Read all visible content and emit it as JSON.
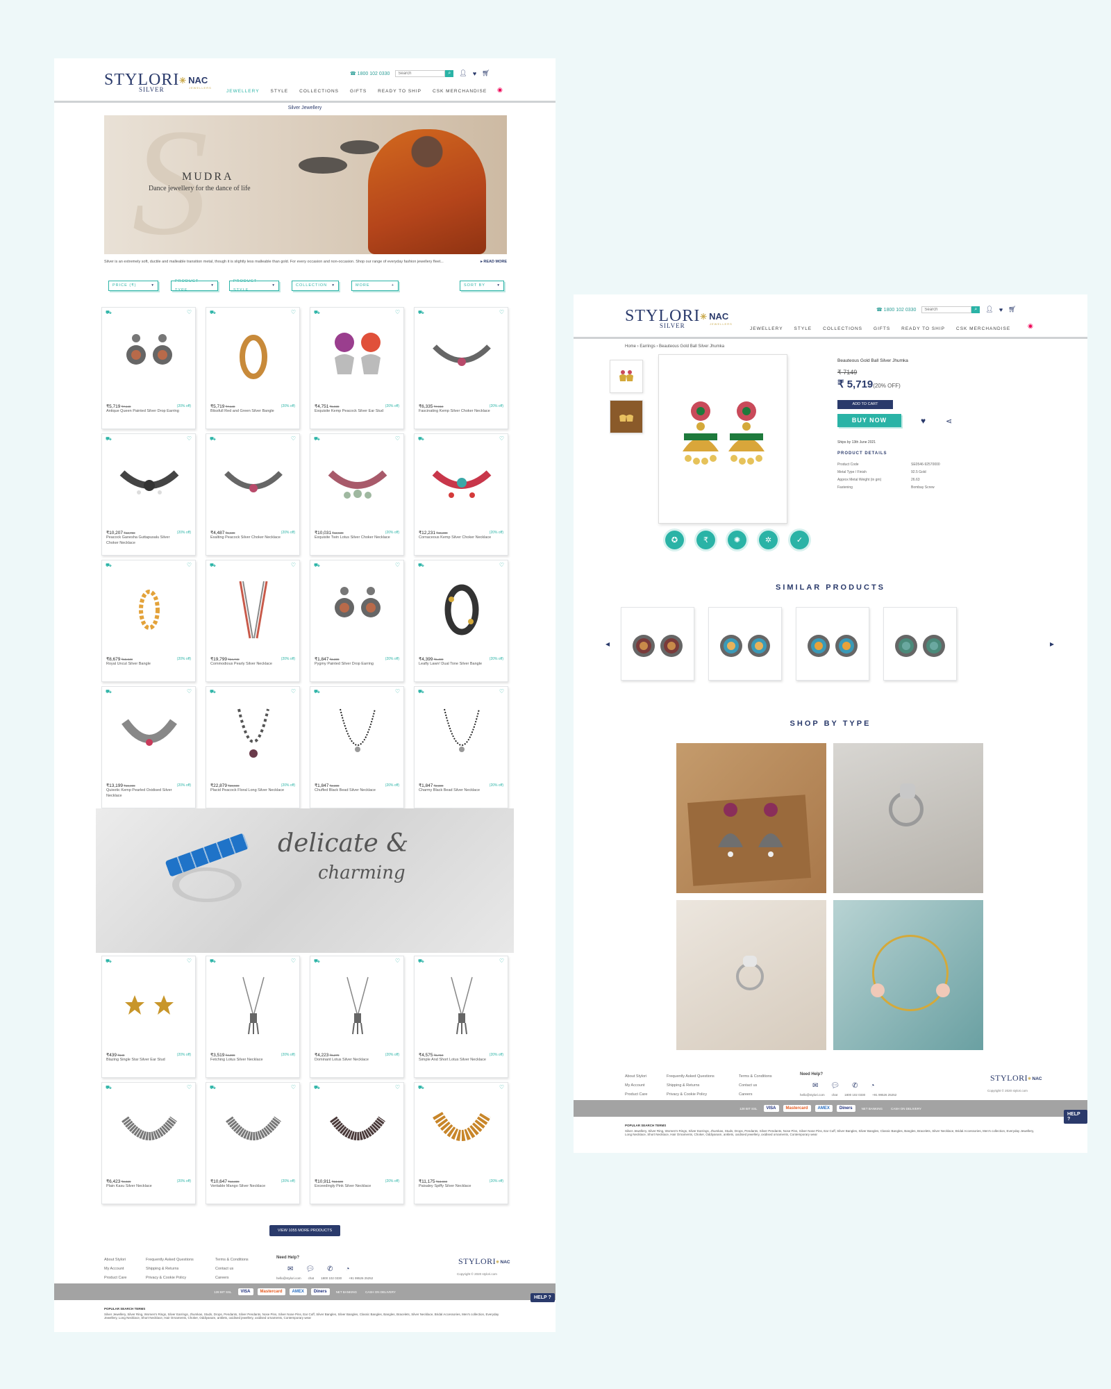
{
  "header": {
    "logo_main": "STYLORI",
    "logo_sub": "SILVER",
    "logo_partner": "NAC",
    "logo_partner_sub": "JEWELLERS",
    "phone": "1800 102 0330",
    "search_placeholder": "Search",
    "nav": [
      "JEWELLERY",
      "STYLE",
      "COLLECTIONS",
      "GIFTS",
      "READY TO SHIP",
      "CSK MERCHANDISE"
    ]
  },
  "listing": {
    "category_title": "Silver Jewellery",
    "banner_title": "MUDRA",
    "banner_subtitle": "Dance jewellery for the dance of life",
    "intro_text": "Silver is an extremely soft, ductile and malleable transition metal, though it is slightly less malleable than gold. For every occasion and non-occasion. Shop our range of everyday fashion jewellery fleet...",
    "read_more": "▸ READ MORE",
    "filters": [
      {
        "label": "PRICE (₹)",
        "caret": "▾"
      },
      {
        "label": "PRODUCT TYPE",
        "caret": "▾"
      },
      {
        "label": "PRODUCT STYLE",
        "caret": "▾"
      },
      {
        "label": "COLLECTION",
        "caret": "▾"
      },
      {
        "label": "MORE",
        "caret": "+"
      },
      {
        "label": "SORT BY",
        "caret": "▾"
      }
    ],
    "products_top": [
      {
        "price": "₹5,719",
        "mrp": "₹7,149",
        "off": "(20% off)",
        "name": "Antique Queen Painted Silver Drop Earring",
        "img": "drop-earrings"
      },
      {
        "price": "₹5,719",
        "mrp": "₹7,149",
        "off": "(20% off)",
        "name": "Blissfull Red and Green Silver Bangle",
        "img": "bangle-gold"
      },
      {
        "price": "₹4,751",
        "mrp": "₹5,939",
        "off": "(20% off)",
        "name": "Exquisite Kemp Peacock Silver Ear Stud",
        "img": "kemp-earrings"
      },
      {
        "price": "₹6,335",
        "mrp": "₹7,919",
        "off": "(20% off)",
        "name": "Fascinating Kemp Silver Choker Necklace",
        "img": "choker"
      },
      {
        "price": "₹10,207",
        "mrp": "₹12,759",
        "off": "(20% off)",
        "name": "Peacock Ganesha Guttapusalu Silver Choker Necklace",
        "img": "choker-dark"
      },
      {
        "price": "₹4,487",
        "mrp": "₹5,609",
        "off": "(20% off)",
        "name": "Exalting Peacock Silver Choker Necklace",
        "img": "choker"
      },
      {
        "price": "₹10,031",
        "mrp": "₹12,539",
        "off": "(20% off)",
        "name": "Exquisite Twin Lotus Silver Choker Necklace",
        "img": "choker-pink"
      },
      {
        "price": "₹12,231",
        "mrp": "₹15,289",
        "off": "(20% off)",
        "name": "Cornaceous Kemp Silver Choker Necklace",
        "img": "choker-red"
      },
      {
        "price": "₹8,679",
        "mrp": "₹10,849",
        "off": "(20% off)",
        "name": "Royal Uncut Silver Bangle",
        "img": "bangle-stones"
      },
      {
        "price": "₹19,799",
        "mrp": "₹24,749",
        "off": "(20% off)",
        "name": "Commodious Pearly Silver Necklace",
        "img": "long-necklace"
      },
      {
        "price": "₹1,847",
        "mrp": "₹2,309",
        "off": "(20% off)",
        "name": "Pygmy Painted Silver Drop Earring",
        "img": "drop-earrings"
      },
      {
        "price": "₹4,399",
        "mrp": "₹5,499",
        "off": "(20% off)",
        "name": "Leafly Lawn! Dual Tone Silver Bangle",
        "img": "bangle-dark"
      },
      {
        "price": "₹13,199",
        "mrp": "₹16,499",
        "off": "(20% off)",
        "name": "Quixotic Kemp Pearled Oxidised Silver Necklace",
        "img": "collar"
      },
      {
        "price": "₹22,879",
        "mrp": "₹28,599",
        "off": "(20% off)",
        "name": "Placid Peacock Floral Long Silver Necklace",
        "img": "long-floral"
      },
      {
        "price": "₹1,847",
        "mrp": "₹2,309",
        "off": "(20% off)",
        "name": "Chuffed Black Bead Silver Necklace",
        "img": "black-bead"
      },
      {
        "price": "₹1,847",
        "mrp": "₹2,309",
        "off": "(20% off)",
        "name": "Charmy Black Bead Silver Necklace",
        "img": "black-bead"
      }
    ],
    "banner2_line1": "delicate &",
    "banner2_line2": "charming",
    "products_bottom": [
      {
        "price": "₹439",
        "mrp": "₹549",
        "off": "(20% off)",
        "name": "Blazing Single Star Silver Ear Stud",
        "img": "star-studs"
      },
      {
        "price": "₹3,519",
        "mrp": "₹4,399",
        "off": "(20% off)",
        "name": "Fetching Lotus Silver Necklace",
        "img": "pendant"
      },
      {
        "price": "₹4,223",
        "mrp": "₹5,279",
        "off": "(20% off)",
        "name": "Dominant Lotus Silver Necklace",
        "img": "pendant"
      },
      {
        "price": "₹4,575",
        "mrp": "₹5,719",
        "off": "(20% off)",
        "name": "Simple And Short Lotus Silver Necklace",
        "img": "pendant"
      },
      {
        "price": "₹6,423",
        "mrp": "₹8,029",
        "off": "(20% off)",
        "name": "Plain Kasu Silver Necklace",
        "img": "collar-silver"
      },
      {
        "price": "₹10,647",
        "mrp": "₹13,309",
        "off": "(20% off)",
        "name": "Veritable Mango Silver Necklace",
        "img": "collar-silver"
      },
      {
        "price": "₹10,911",
        "mrp": "₹13,639",
        "off": "(20% off)",
        "name": "Exceedingly Pink Silver Necklace",
        "img": "collar-dark"
      },
      {
        "price": "₹11,175",
        "mrp": "₹13,969",
        "off": "(20% off)",
        "name": "Paisaley Spiffy Silver Necklace",
        "img": "collar-gold"
      }
    ],
    "view_more": "VIEW 1055 MORE PRODUCTS"
  },
  "footer": {
    "col1": [
      "About Stylori",
      "My Account",
      "Product Care"
    ],
    "col2": [
      "Frequently Asked Questions",
      "Shipping & Returns",
      "Privacy & Cookie Policy"
    ],
    "col3": [
      "Terms & Conditions",
      "Contact us",
      "Careers"
    ],
    "need_help": "Need Help?",
    "contacts": [
      "hello@stylori.com",
      "chat",
      "1800 102 0330",
      "+91 99526 25252"
    ],
    "copyright": "Copyright © 2020 stylori.com",
    "payments": [
      "128 BIT SSL",
      "VISA",
      "Mastercard",
      "AMEX",
      "Diners",
      "NET BANKING",
      "CASH ON DELIVERY"
    ],
    "popular_title": "POPULAR SEARCH TERMS",
    "popular_text": "Silver Jewellery, Silver Ring, Women's Rings, Silver Earrings, Jhumkas, Studs, Drops, Pendants, Silver Pendants, Nose Pins, Silver Nose Pins, Ear Cuff, Silver Bangles, Silver Bangles, Classic Bangles, Bangles, Bracelets, Silver Necklace, Bridal Accessories, Men's collection, Everyday Jewellery, Long Necklace, Short Necklace, Hair Ornaments, Choker, Oddiyanam, anklets, oxidised jewellery, oxidised ornaments, Contemporary wear",
    "help": "HELP ?"
  },
  "product": {
    "breadcrumb": [
      "Home",
      "Earrings",
      "Beauteous Gold Ball Silver Jhumka"
    ],
    "title": "Beauteous Gold Ball Silver Jhumka",
    "mrp": "₹ 7149",
    "price": "₹ 5,719",
    "discount": "(20% OFF)",
    "add_to_cart": "ADD TO CART",
    "buy_now": "BUY NOW",
    "ships_by": "Ships by 13th June 2021",
    "details_title": "PRODUCT DETAILS",
    "details": [
      {
        "k": "Product Code",
        "v": "SE0546-92570000"
      },
      {
        "k": "Metal Type / Finish",
        "v": "92.5 Gold"
      },
      {
        "k": "Approx Metal Weight (in gm)",
        "v": "26.63"
      },
      {
        "k": "Fastening",
        "v": "Bombay Screw"
      }
    ],
    "badges": [
      "quality-icon",
      "price-icon",
      "craft-icon",
      "design-icon",
      "shield-icon"
    ],
    "similar_title": "SIMILAR PRODUCTS",
    "shop_by_type_title": "SHOP BY TYPE"
  },
  "colors": {
    "teal": "#2ab3a6",
    "navy": "#2a3a6b",
    "bg": "#eef8f9"
  }
}
